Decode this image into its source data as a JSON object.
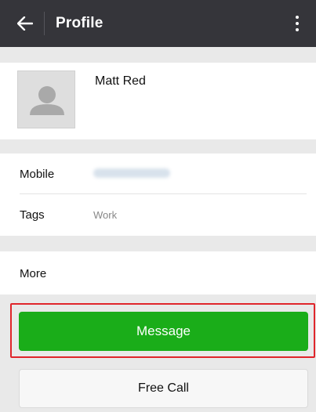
{
  "header": {
    "title": "Profile"
  },
  "contact": {
    "name": "Matt Red"
  },
  "info": {
    "mobile_label": "Mobile",
    "tags_label": "Tags",
    "tags_value": "Work"
  },
  "more": {
    "label": "More"
  },
  "actions": {
    "message_label": "Message",
    "free_call_label": "Free Call"
  },
  "colors": {
    "topbar": "#35353a",
    "accent_green": "#1aad19",
    "highlight_red": "#e0252b"
  }
}
